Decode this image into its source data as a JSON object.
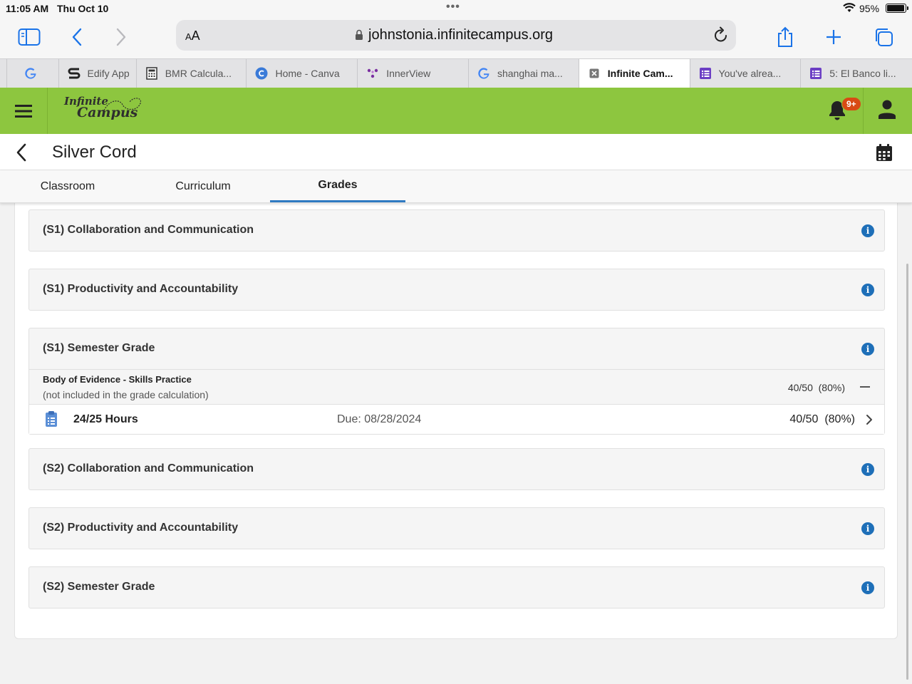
{
  "status": {
    "time": "11:05 AM",
    "date": "Thu Oct 10",
    "battery": "95%",
    "battery_level": 0.95
  },
  "browser": {
    "text_size_label": "AA",
    "url": "johnstonia.infinitecampus.org",
    "tabs": [
      {
        "label": "",
        "icon": "google-icon"
      },
      {
        "label": "Edify App",
        "icon": "edify-icon"
      },
      {
        "label": "BMR Calcula...",
        "icon": "calculator-icon"
      },
      {
        "label": "Home - Canva",
        "icon": "canva-icon"
      },
      {
        "label": "InnerView",
        "icon": "innerview-icon"
      },
      {
        "label": "shanghai ma...",
        "icon": "google-icon"
      },
      {
        "label": "Infinite Cam...",
        "icon": "close-icon",
        "active": true
      },
      {
        "label": "You've alrea...",
        "icon": "forms-icon"
      },
      {
        "label": "5: El Banco li...",
        "icon": "forms-icon"
      }
    ]
  },
  "app": {
    "logo_top": "Infinite",
    "logo_bottom": "Campus",
    "notification_badge": "9+",
    "page_title": "Silver Cord",
    "section_tabs": [
      "Classroom",
      "Curriculum",
      "Grades"
    ],
    "active_section": "Grades"
  },
  "cards": [
    {
      "title": "(S1) Collaboration and Communication"
    },
    {
      "title": "(S1) Productivity and Accountability"
    },
    {
      "title": "(S1) Semester Grade",
      "evidence": {
        "title": "Body of Evidence - Skills Practice",
        "subtitle": "(not included in the grade calculation)",
        "score": "40/50  (80%)"
      },
      "assignment": {
        "name": "24/25 Hours",
        "due": "Due: 08/28/2024",
        "score": "40/50  (80%)"
      }
    },
    {
      "title": "(S2) Collaboration and Communication"
    },
    {
      "title": "(S2) Productivity and Accountability"
    },
    {
      "title": "(S2) Semester Grade"
    }
  ],
  "colors": {
    "header_green": "#8dc63f",
    "accent_blue": "#1e6fb8",
    "badge_orange": "#d84a14"
  }
}
